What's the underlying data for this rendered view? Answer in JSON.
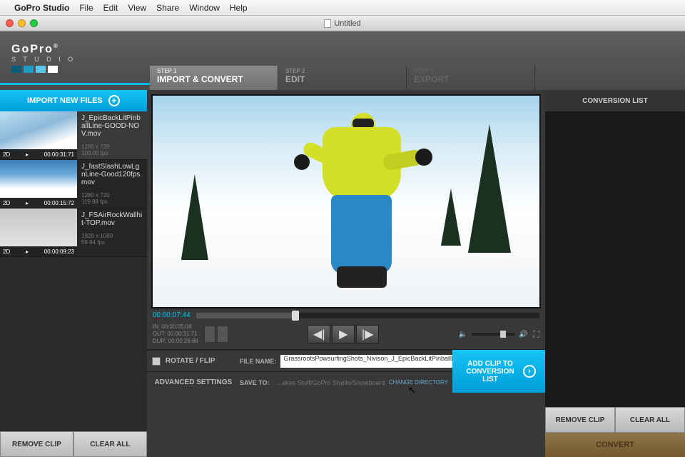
{
  "menubar": {
    "appname": "GoPro Studio",
    "items": [
      "File",
      "Edit",
      "View",
      "Share",
      "Window",
      "Help"
    ]
  },
  "window": {
    "title": "Untitled"
  },
  "steps": {
    "s1num": "STEP 1",
    "s1": "IMPORT & CONVERT",
    "s2num": "STEP 2",
    "s2": "EDIT",
    "s3num": "STEP 3",
    "s3": "EXPORT"
  },
  "left": {
    "import_label": "IMPORT NEW FILES",
    "clips": [
      {
        "name": "J_EpicBackLitPinballLine-GOOD-NOV.mov",
        "badge": "2D",
        "tc": "00:00:31:71",
        "res": "1280 x 720",
        "fps": "100.00 fps"
      },
      {
        "name": "J_fastSlashLowLgnLine-Good120fps.mov",
        "badge": "2D",
        "tc": "00:00:15:72",
        "res": "1280 x 720",
        "fps": "119.88 fps"
      },
      {
        "name": "J_FSAirRockWallhit-TOP.mov",
        "badge": "2D",
        "tc": "00:00:09:23",
        "res": "1920 x 1080",
        "fps": "59.94 fps"
      }
    ],
    "remove": "REMOVE CLIP",
    "clear": "CLEAR ALL"
  },
  "player": {
    "timecode": "00:00:07:44",
    "in": "IN:  00:00:05:08",
    "out": "OUT: 00:00:31:71",
    "dur": "DUR: 00:00:26:66"
  },
  "settings": {
    "rotate": "ROTATE / FLIP",
    "filename_label": "FILE NAME:",
    "filename": "GrassrootsPowsurfingShots_Nivison_J_EpicBackLitPinballLine-",
    "advanced": "ADVANCED SETTINGS",
    "saveto_label": "SAVE TO:",
    "saveto_path": "...akes Stuff/GoPro Studio/Snowboard Converted",
    "change_dir": "CHANGE DIRECTORY",
    "add_clip": "ADD CLIP TO CONVERSION LIST"
  },
  "right": {
    "header": "CONVERSION LIST",
    "remove": "REMOVE CLIP",
    "clear": "CLEAR ALL",
    "convert": "CONVERT"
  }
}
